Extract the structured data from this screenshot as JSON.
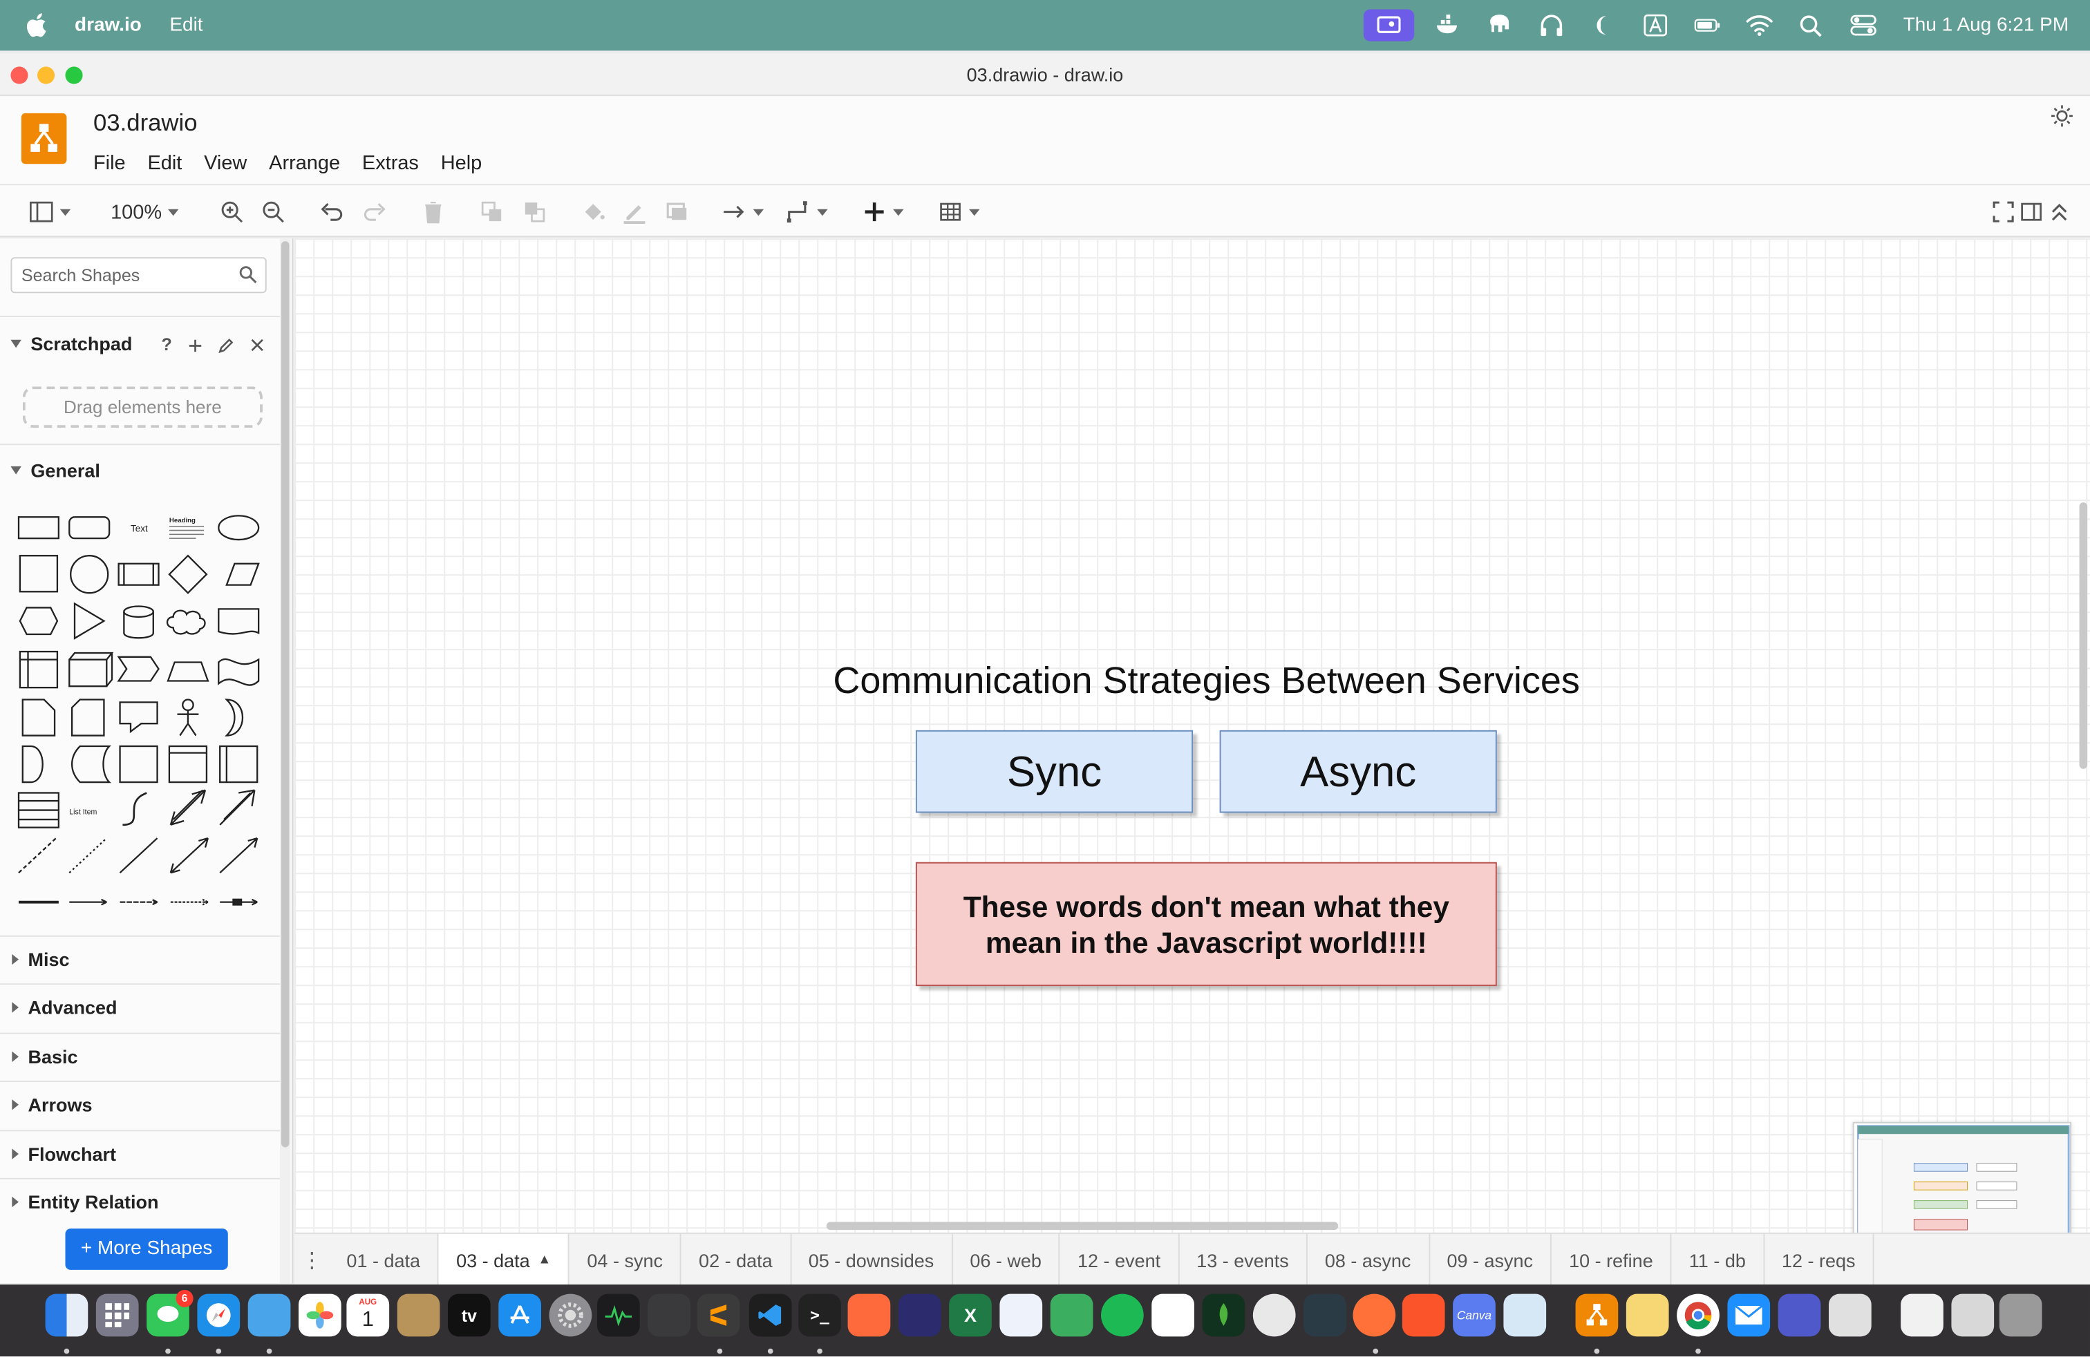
{
  "menubar": {
    "app_name": "draw.io",
    "app_menu": "Edit",
    "clock": "Thu 1 Aug  6:21 PM"
  },
  "window": {
    "title": "03.drawio - draw.io"
  },
  "header": {
    "filename": "03.drawio",
    "menu": [
      "File",
      "Edit",
      "View",
      "Arrange",
      "Extras",
      "Help"
    ]
  },
  "toolbar": {
    "zoom": "100%"
  },
  "sidebar": {
    "search_placeholder": "Search Shapes",
    "scratchpad": {
      "title": "Scratchpad",
      "help": "?",
      "drop_hint": "Drag elements here"
    },
    "general_title": "General",
    "general_text_shape": "Text",
    "general_heading_shape": "Heading",
    "general_list_item": "List Item",
    "collapsed_sections": [
      "Misc",
      "Advanced",
      "Basic",
      "Arrows",
      "Flowchart",
      "Entity Relation"
    ],
    "more_shapes": "+ More Shapes"
  },
  "canvas": {
    "heading": "Communication Strategies Between Services",
    "sync_label": "Sync",
    "async_label": "Async",
    "note_line1": "These words don't mean what they",
    "note_line2": "mean in the Javascript world!!!!"
  },
  "pages": {
    "active_index": 1,
    "tabs": [
      "01 - data",
      "03 - data",
      "04 - sync",
      "02 - data",
      "05 - downsides",
      "06 - web",
      "12 - event",
      "13 - events",
      "08 - async",
      "09 - async",
      "10 - refine",
      "11 - db",
      "12 - reqs"
    ]
  },
  "dock": {
    "calendar_month": "AUG",
    "calendar_day": "1",
    "messages_badge": "6",
    "tv_label": "tv",
    "canva_label": "Canva"
  },
  "colors": {
    "menubar": "#5f9d95",
    "sync_fill": "#dae8fc",
    "sync_stroke": "#6c8ebf",
    "note_fill": "#f8cecc",
    "note_stroke": "#b85450",
    "more_shapes_button": "#1a73e8"
  }
}
